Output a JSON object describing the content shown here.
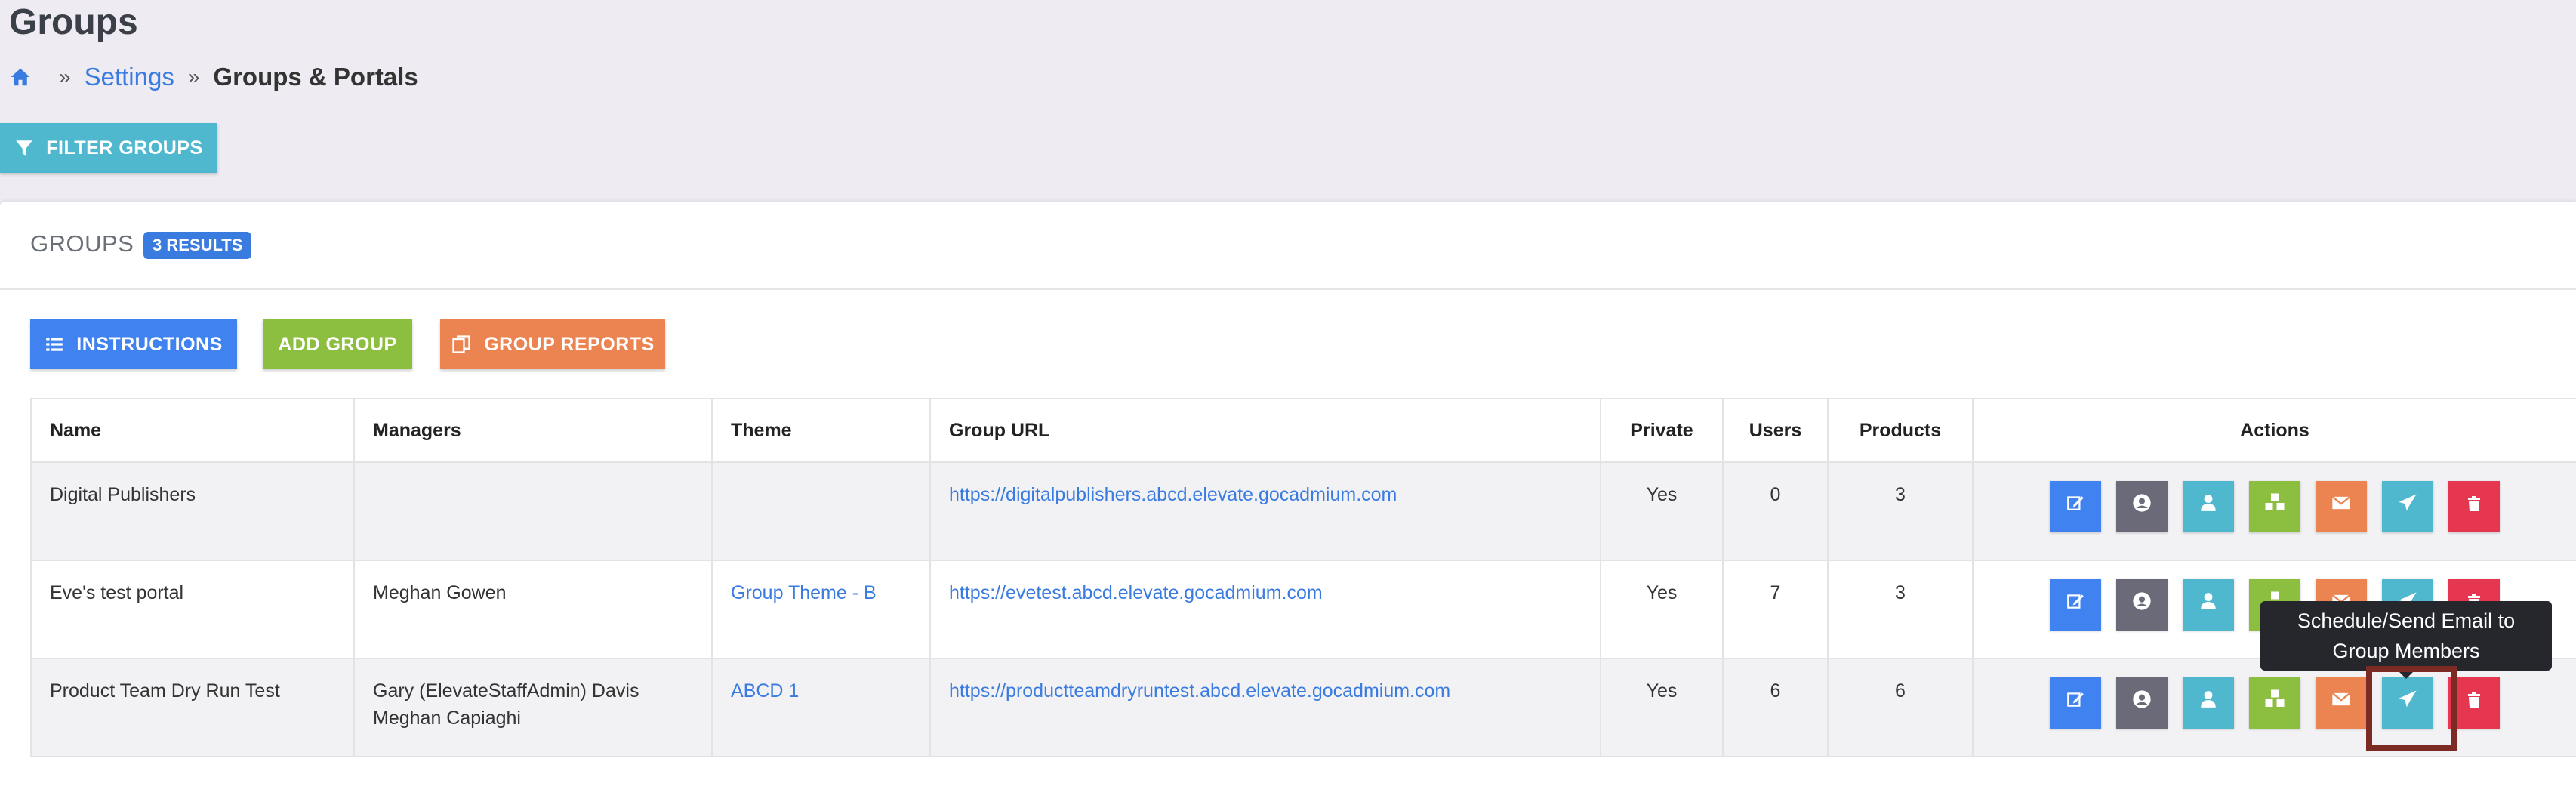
{
  "page": {
    "title": "Groups"
  },
  "breadcrumb": {
    "sep": "»",
    "settings": "Settings",
    "current": "Groups & Portals"
  },
  "filter_button": {
    "label": "FILTER GROUPS"
  },
  "card": {
    "title": "GROUPS",
    "results_badge": "3 RESULTS"
  },
  "toolbar": {
    "instructions": "INSTRUCTIONS",
    "add_group": "ADD GROUP",
    "group_reports": "GROUP REPORTS"
  },
  "table": {
    "headers": {
      "name": "Name",
      "managers": "Managers",
      "theme": "Theme",
      "url": "Group URL",
      "private": "Private",
      "users": "Users",
      "products": "Products",
      "actions": "Actions"
    },
    "rows": [
      {
        "name": "Digital Publishers",
        "manager1": "",
        "manager2": "",
        "theme": "",
        "url": "https://digitalpublishers.abcd.elevate.gocadmium.com",
        "private": "Yes",
        "users": "0",
        "products": "3"
      },
      {
        "name": "Eve's test portal",
        "manager1": "Meghan Gowen",
        "manager2": "",
        "theme": "Group Theme - B",
        "url": "https://evetest.abcd.elevate.gocadmium.com",
        "private": "Yes",
        "users": "7",
        "products": "3"
      },
      {
        "name": "Product Team Dry Run Test",
        "manager1": "Gary (ElevateStaffAdmin) Davis",
        "manager2": "Meghan Capiaghi",
        "theme": "ABCD 1",
        "url": "https://productteamdryruntest.abcd.elevate.gocadmium.com",
        "private": "Yes",
        "users": "6",
        "products": "6"
      }
    ]
  },
  "tooltip": {
    "text": "Schedule/Send Email to Group Members"
  },
  "colors": {
    "primary": "#3f82f0",
    "info": "#4fb8cf",
    "success": "#8cbf3f",
    "warning": "#ec8452",
    "danger": "#e5374f",
    "dark": "#6a6a78"
  },
  "icons": {
    "home": "home-icon",
    "filter": "filter-icon",
    "list": "list-icon",
    "reports": "copy-icon",
    "edit": "edit-icon",
    "profile": "user-circle-icon",
    "user": "user-icon",
    "cubes": "cubes-icon",
    "mail": "envelope-icon",
    "send": "paper-plane-icon",
    "trash": "trash-icon"
  }
}
